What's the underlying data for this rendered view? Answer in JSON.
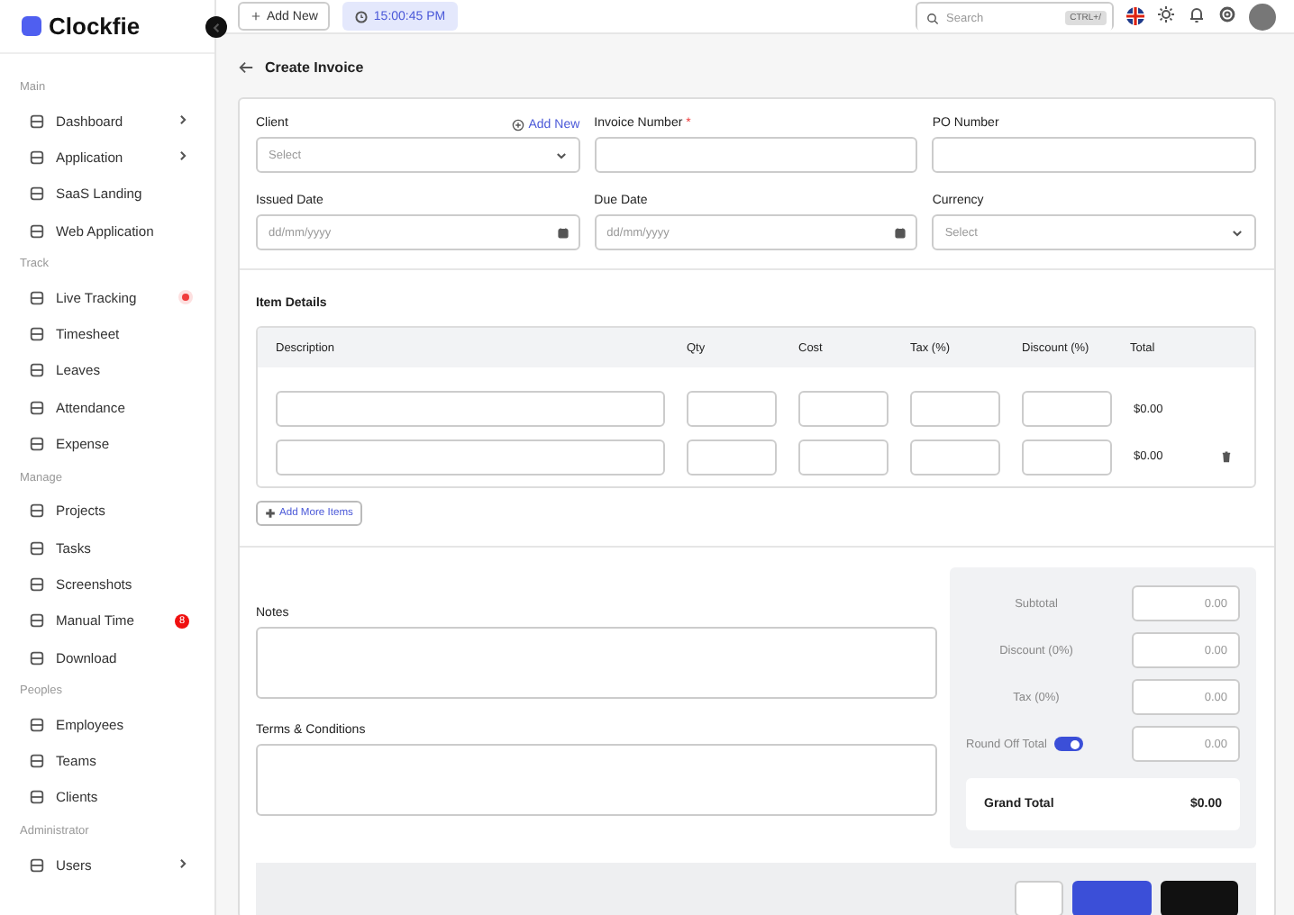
{
  "brand": {
    "name": "Clockfie"
  },
  "topbar": {
    "add_button": "Add New",
    "clock": "15:00:45 PM",
    "search": {
      "placeholder": "Search",
      "shortcut": "CTRL+/"
    }
  },
  "sidebar": {
    "sections": [
      {
        "title": "Main",
        "items": [
          {
            "label": "Dashboard",
            "expandable": true,
            "live": false
          },
          {
            "label": "Application",
            "expandable": true,
            "live": false
          },
          {
            "label": "SaaS Landing",
            "expandable": false,
            "live": false
          },
          {
            "label": "Web Application",
            "expandable": false,
            "live": false
          }
        ]
      },
      {
        "title": "Track",
        "items": [
          {
            "label": "Live Tracking",
            "expandable": false,
            "live": true
          },
          {
            "label": "Timesheet",
            "expandable": false,
            "live": false
          },
          {
            "label": "Leaves",
            "expandable": false,
            "live": false
          },
          {
            "label": "Attendance",
            "expandable": false,
            "live": false
          },
          {
            "label": "Expense",
            "expandable": false,
            "live": false
          }
        ]
      },
      {
        "title": "Manage",
        "items": [
          {
            "label": "Projects",
            "expandable": false,
            "live": false
          },
          {
            "label": "Tasks",
            "expandable": false,
            "live": false
          },
          {
            "label": "Screenshots",
            "expandable": false,
            "live": false
          },
          {
            "label": "Manual Time",
            "expandable": false,
            "live": false,
            "badge": "8"
          },
          {
            "label": "Download",
            "expandable": false,
            "live": false
          }
        ]
      },
      {
        "title": "Peoples",
        "items": [
          {
            "label": "Employees",
            "expandable": false,
            "live": false
          },
          {
            "label": "Teams",
            "expandable": false,
            "live": false
          },
          {
            "label": "Clients",
            "expandable": false,
            "live": false
          }
        ]
      },
      {
        "title": "Administrator",
        "items": [
          {
            "label": "Users",
            "expandable": true,
            "live": false
          }
        ]
      }
    ]
  },
  "page": {
    "title": "Create Invoice"
  },
  "fields": [
    {
      "kind": "select",
      "label": "Client",
      "placeholder": "Select",
      "action": "Add New"
    },
    {
      "kind": "text",
      "label": "Invoice Number",
      "required_mark": "*"
    },
    {
      "kind": "text",
      "label": "PO Number"
    },
    {
      "kind": "date",
      "label": "Issued Date",
      "placeholder": "dd/mm/yyyy"
    },
    {
      "kind": "date",
      "label": "Due Date",
      "placeholder": "dd/mm/yyyy"
    },
    {
      "kind": "select",
      "label": "Currency",
      "placeholder": "Select"
    }
  ],
  "items": {
    "title": "Item Details",
    "columns": [
      "Description",
      "Qty",
      "Cost",
      "Tax (%)",
      "Discount (%)",
      "Total"
    ],
    "rows": [
      {
        "total": "$0.00",
        "removable": false
      },
      {
        "total": "$0.00",
        "removable": true
      }
    ],
    "add_button": "Add More Items"
  },
  "notes": {
    "label": "Notes"
  },
  "terms": {
    "label": "Terms & Conditions"
  },
  "summary": {
    "rows": [
      {
        "kind": "plain",
        "label": "Subtotal",
        "placeholder": "0.00"
      },
      {
        "kind": "plain",
        "label": "Discount (0%)",
        "placeholder": "0.00"
      },
      {
        "kind": "plain",
        "label": "Tax (0%)",
        "placeholder": "0.00"
      },
      {
        "kind": "toggle",
        "label": "Round Off Total",
        "placeholder": "0.00",
        "on": true
      }
    ],
    "grand_total": {
      "label": "Grand Total",
      "value": "$0.00"
    }
  },
  "footer_buttons": [
    {
      "kind": "outline"
    },
    {
      "kind": "primary"
    },
    {
      "kind": "dark"
    }
  ]
}
